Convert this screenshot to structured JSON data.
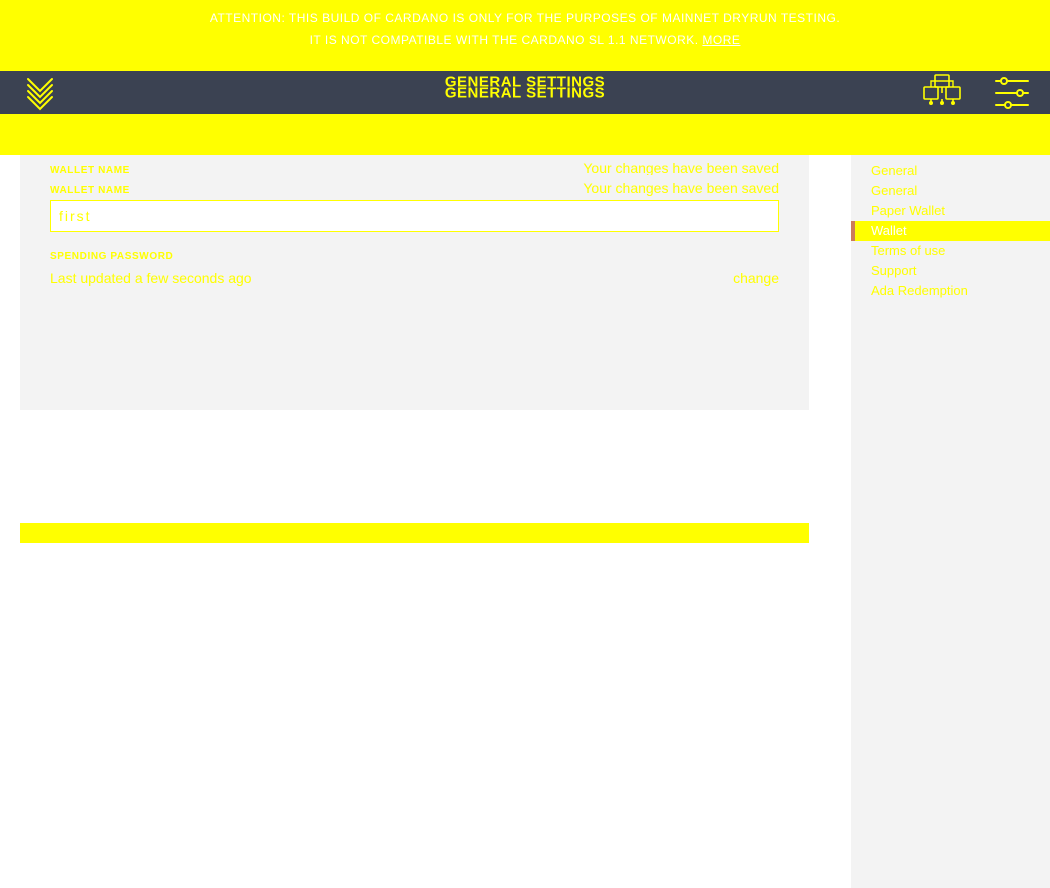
{
  "notice": {
    "line1": "ATTENTION: THIS BUILD OF CARDANO IS ONLY FOR THE PURPOSES OF MAINNET DRYRUN TESTING.",
    "line2": "IT IS NOT COMPATIBLE WITH THE CARDANO SL 1.1 NETWORK.",
    "link": "MORE"
  },
  "header": {
    "title": "GENERAL SETTINGS"
  },
  "main": {
    "wallet_name_label": "WALLET NAME",
    "wallet_name_status": "Your changes have been saved",
    "wallet_name_value": "first",
    "spending_password_label": "SPENDING PASSWORD",
    "spending_password_status": "Last updated a few seconds ago",
    "spending_password_action": "change"
  },
  "sidebar": {
    "items": [
      {
        "label": "General",
        "key": "general"
      },
      {
        "label": "Paper Wallet",
        "key": "paper-wallet"
      },
      {
        "label": "Wallet",
        "key": "wallet"
      },
      {
        "label": "Terms of use",
        "key": "terms"
      },
      {
        "label": "Support",
        "key": "support"
      },
      {
        "label": "Ada Redemption",
        "key": "ada"
      }
    ],
    "active": "Wallet"
  }
}
